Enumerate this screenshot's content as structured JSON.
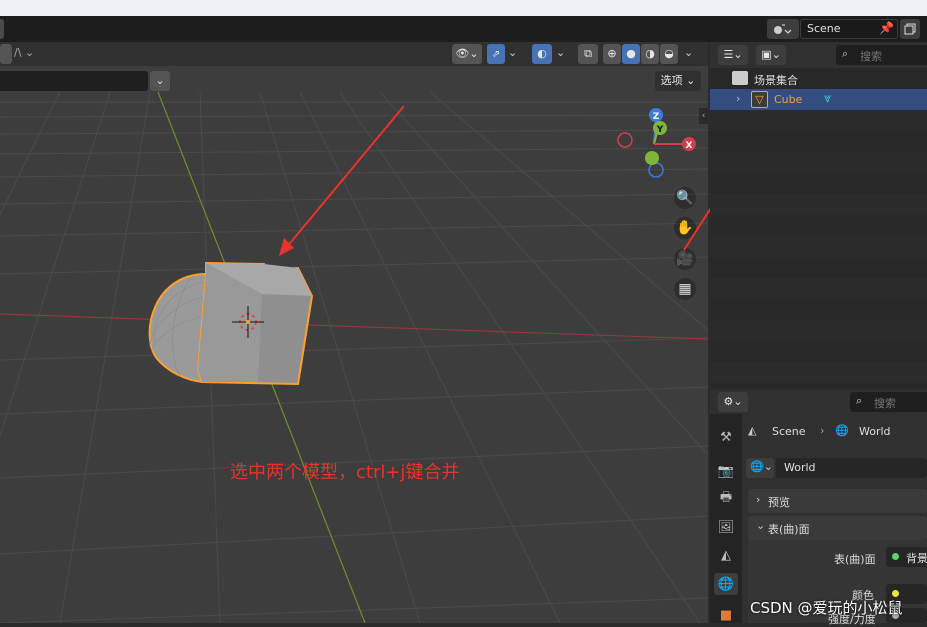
{
  "header": {
    "scene_label": "Scene"
  },
  "viewport": {
    "options_label": "选项",
    "annotation": "选中两个模型，ctrl+j键合并",
    "gizmo": {
      "z": "Z",
      "y": "Y",
      "x": "X"
    }
  },
  "outliner": {
    "search_placeholder": "搜索",
    "collection_label": "场景集合",
    "object_label": "Cube"
  },
  "properties": {
    "search_placeholder": "搜索",
    "breadcrumb_scene": "Scene",
    "breadcrumb_world": "World",
    "world_field": "World",
    "preview_label": "预览",
    "surface_label": "表(曲)面",
    "surface_row_label": "表(曲)面",
    "surface_value": "背景",
    "color_label": "颜色",
    "strength_label": "强度/力度"
  },
  "watermark": "CSDN @爱玩的小松鼠",
  "colors": {
    "accent": "#4772b3",
    "selection": "#ff9f2e",
    "arrow": "#e8322a",
    "x_axis": "#d1404a",
    "y_axis": "#7fb63a",
    "z_axis": "#3d7ae0"
  }
}
